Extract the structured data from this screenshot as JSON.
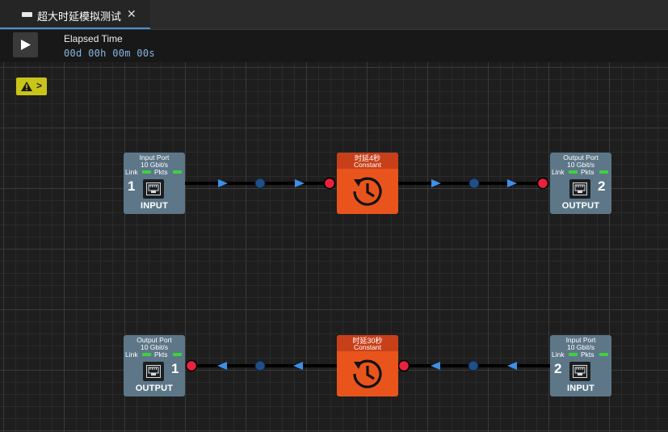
{
  "tab": {
    "title": "超大时延模拟测试",
    "icon": "window-icon",
    "close": "✕"
  },
  "toolbar": {
    "play_icon": "play-icon",
    "elapsed_label": "Elapsed Time",
    "elapsed_value": "00d 00h 00m 00s"
  },
  "warning": {
    "icon": "warning-icon",
    "chevron": ">"
  },
  "colors": {
    "port_bg": "#5d7788",
    "delay_bg": "#e9541c",
    "led": "#3fd13f",
    "endpoint": "#e8223c",
    "dot": "#1f4f86",
    "arrow": "#3d8fe8",
    "warning": "#c9c41a",
    "accent": "#4c8fd6"
  },
  "ports": [
    {
      "name": "Input Port",
      "speed": "10 Gbit/s",
      "link": "Link",
      "pkts": "Pkts",
      "number": "1",
      "role": "INPUT",
      "icon": "ethernet-port-icon"
    },
    {
      "name": "Output Port",
      "speed": "10 Gbit/s",
      "link": "Link",
      "pkts": "Pkts",
      "number": "2",
      "role": "OUTPUT",
      "icon": "ethernet-port-icon"
    },
    {
      "name": "Output Port",
      "speed": "10 Gbit/s",
      "link": "Link",
      "pkts": "Pkts",
      "number": "1",
      "role": "OUTPUT",
      "icon": "ethernet-port-icon"
    },
    {
      "name": "Input Port",
      "speed": "10 Gbit/s",
      "link": "Link",
      "pkts": "Pkts",
      "number": "2",
      "role": "INPUT",
      "icon": "ethernet-port-icon"
    }
  ],
  "delays": [
    {
      "title": "时延4秒",
      "mode": "Constant",
      "icon": "history-clock-icon"
    },
    {
      "title": "时延30秒",
      "mode": "Constant",
      "icon": "history-clock-icon"
    }
  ]
}
